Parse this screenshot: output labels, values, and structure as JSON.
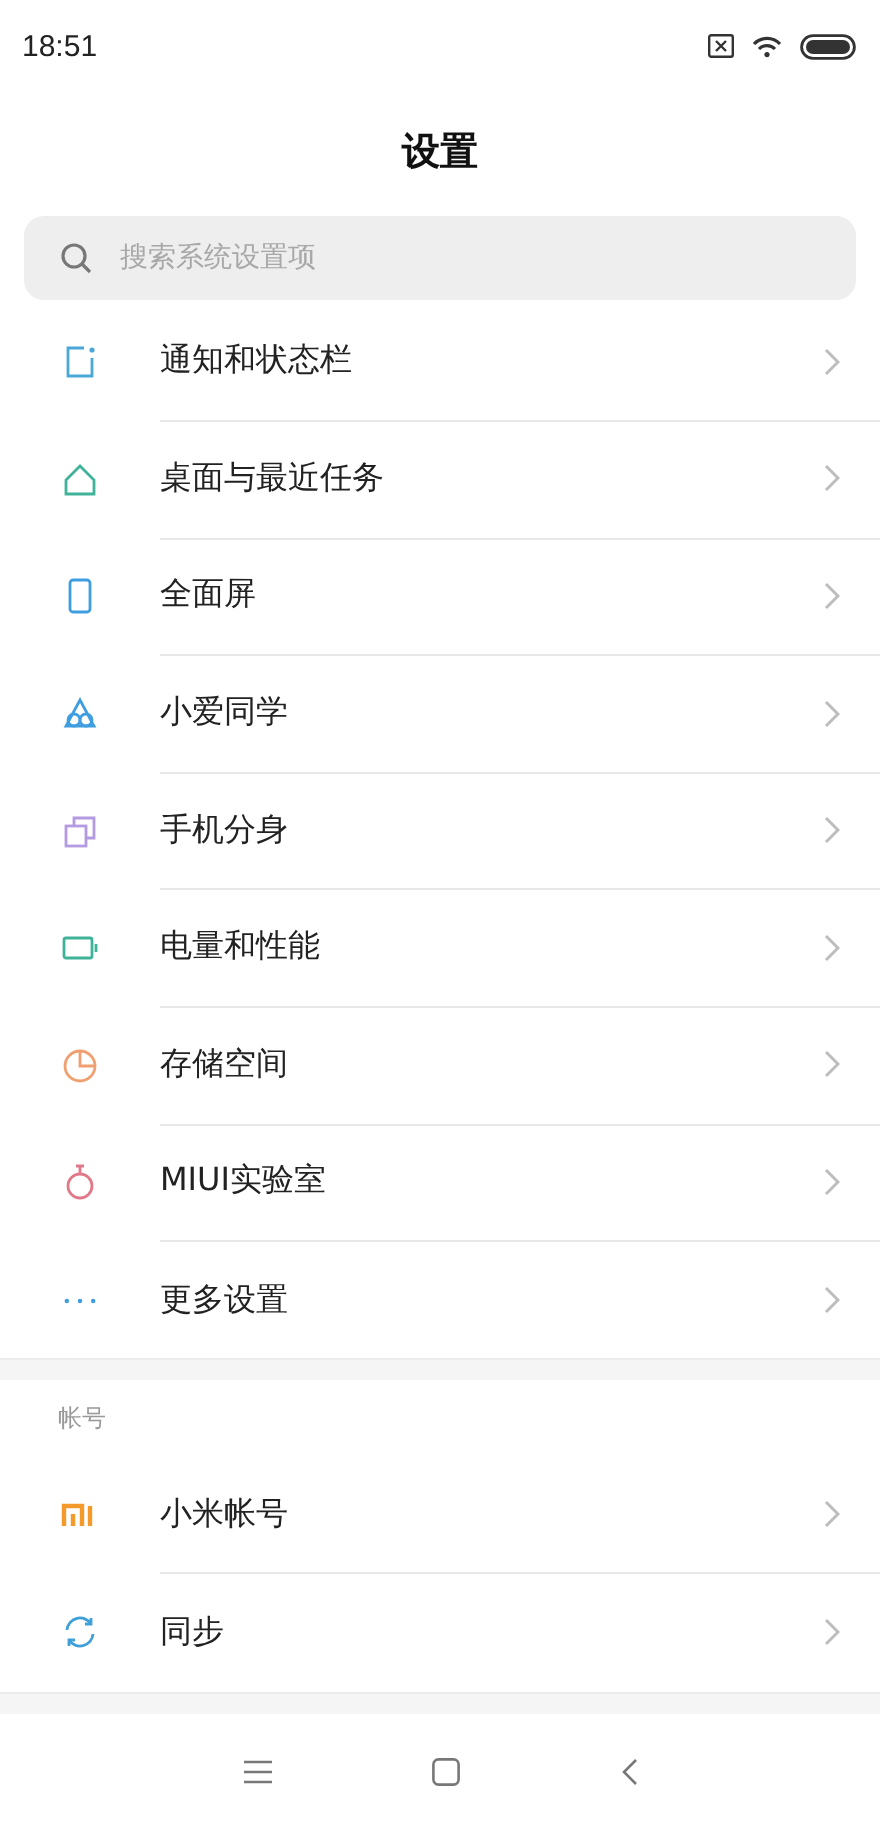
{
  "status_bar": {
    "time": "18:51"
  },
  "title": "设置",
  "search": {
    "placeholder": "搜索系统设置项"
  },
  "sections": [
    {
      "items": [
        {
          "label": "通知和状态栏",
          "kind": "notification",
          "color": "#4aa8d8"
        },
        {
          "label": "桌面与最近任务",
          "kind": "home",
          "color": "#3fb39a"
        },
        {
          "label": "全面屏",
          "kind": "phone",
          "color": "#3f9ee0"
        },
        {
          "label": "小爱同学",
          "kind": "assistant",
          "color": "#3f9ee0"
        },
        {
          "label": "手机分身",
          "kind": "clone",
          "color": "#b49ae0"
        },
        {
          "label": "电量和性能",
          "kind": "battery",
          "color": "#3fb39a"
        },
        {
          "label": "存储空间",
          "kind": "storage",
          "color": "#f0a070"
        },
        {
          "label": "MIUI实验室",
          "kind": "lab",
          "color": "#e07a8a"
        },
        {
          "label": "更多设置",
          "kind": "more",
          "color": "#3f9ee0"
        }
      ]
    },
    {
      "header": "帐号",
      "items": [
        {
          "label": "小米帐号",
          "kind": "mi",
          "color": "#f39a2a"
        },
        {
          "label": "同步",
          "kind": "sync",
          "color": "#3fa0d8"
        }
      ]
    }
  ]
}
